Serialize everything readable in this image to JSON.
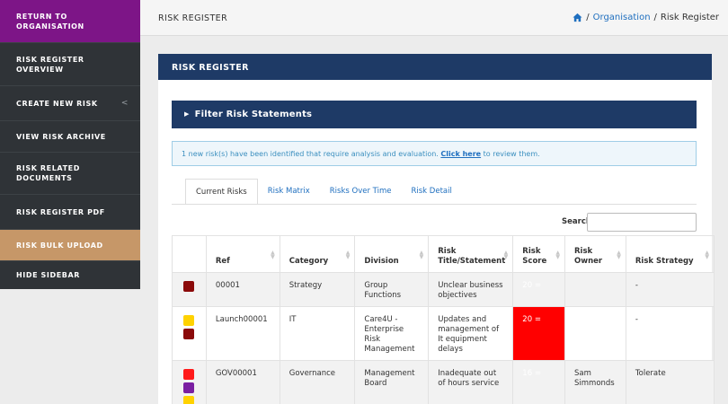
{
  "sidebar": {
    "items": [
      {
        "label": "RETURN TO ORGANISATION"
      },
      {
        "label": "RISK REGISTER OVERVIEW"
      },
      {
        "label": "CREATE NEW RISK"
      },
      {
        "label": "VIEW RISK ARCHIVE"
      },
      {
        "label": "RISK RELATED DOCUMENTS"
      },
      {
        "label": "RISK REGISTER PDF"
      },
      {
        "label": "RISK BULK UPLOAD"
      },
      {
        "label": "HIDE SIDEBAR"
      }
    ],
    "create_caret": "<"
  },
  "header": {
    "title": "RISK REGISTER",
    "breadcrumb": {
      "separator1": "/",
      "organisation": "Organisation",
      "separator2": "/",
      "current": "Risk Register"
    }
  },
  "panel": {
    "title": "RISK REGISTER",
    "filter_label": "Filter Risk Statements",
    "alert": {
      "before": "1 new risk(s) have been identified that require analysis and evaluation. ",
      "link": "Click here",
      "after": " to review them."
    },
    "tabs": [
      "Current Risks",
      "Risk Matrix",
      "Risks Over Time",
      "Risk Detail"
    ],
    "search_label": "Search:",
    "search_value": ""
  },
  "table": {
    "headers": [
      "",
      "Ref",
      "Category",
      "Division",
      "Risk Title/Statement",
      "Risk Score",
      "Risk Owner",
      "Risk Strategy"
    ],
    "rows": [
      {
        "colors": [
          "#8b0a0a"
        ],
        "ref": "00001",
        "category": "Strategy",
        "division": "Group Functions",
        "title": "Unclear business objectives",
        "score": "20 =",
        "owner": "",
        "strategy": "-"
      },
      {
        "colors": [
          "#ffd200",
          "#8b0a0a"
        ],
        "ref": "Launch00001",
        "category": "IT",
        "division": "Care4U - Enterprise Risk Management",
        "title": "Updates and management of It equipment delays",
        "score": "20 =",
        "owner": "",
        "strategy": "-"
      },
      {
        "colors": [
          "#ff1a1a",
          "#7a1fa2",
          "#ffd200"
        ],
        "ref": "GOV00001",
        "category": "Governance",
        "division": "Management Board",
        "title": "Inadequate out of hours service",
        "score": "16 =",
        "owner": "Sam Simmonds",
        "strategy": "Tolerate"
      }
    ]
  },
  "colors": {
    "sidebar_bg": "#2f3337",
    "return_bg": "#7d1587",
    "bulk_bg": "#c69768",
    "navy": "#1e3a66",
    "score_red": "#ff0000"
  }
}
